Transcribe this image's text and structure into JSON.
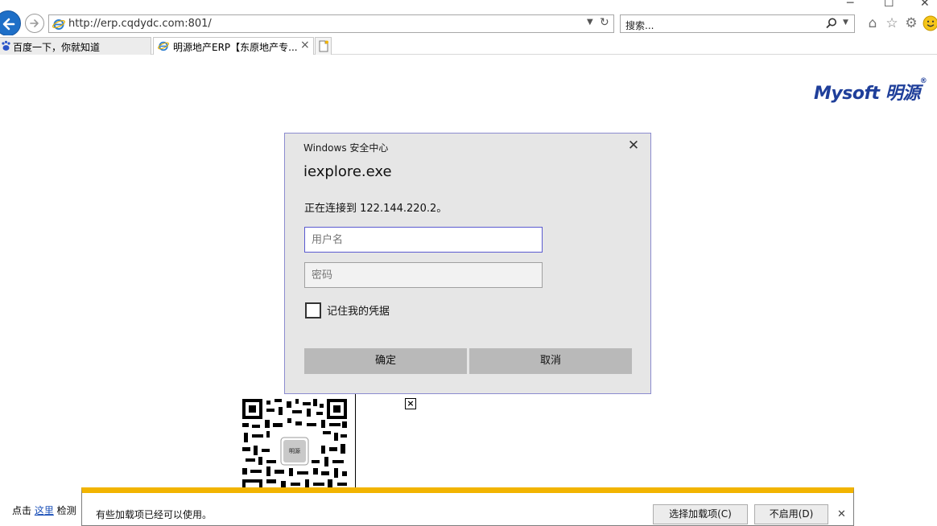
{
  "browser": {
    "url": "http://erp.cqdydc.com:801/",
    "search_placeholder": "搜索...",
    "tabs": [
      {
        "label": "百度一下，你就知道",
        "active": false
      },
      {
        "label": "明源地产ERP【东原地产专...",
        "active": true
      }
    ],
    "accent": "#1e6fc7"
  },
  "page": {
    "logo_text": "Mysoft 明源",
    "logo_mark": "®",
    "qr_center_label": "明源",
    "footer": {
      "prefix": "点击 ",
      "link": "这里",
      "suffix": " 检测"
    }
  },
  "dialog": {
    "caption": "Windows 安全中心",
    "app_name": "iexplore.exe",
    "message": "正在连接到 122.144.220.2。",
    "username_placeholder": "用户名",
    "password_placeholder": "密码",
    "remember_label": "记住我的凭据",
    "ok_label": "确定",
    "cancel_label": "取消"
  },
  "notification": {
    "message": "有些加载项已经可以使用。",
    "choose_label": "选择加载项(C)",
    "disable_label": "不启用(D)",
    "accent": "#f2b400"
  }
}
